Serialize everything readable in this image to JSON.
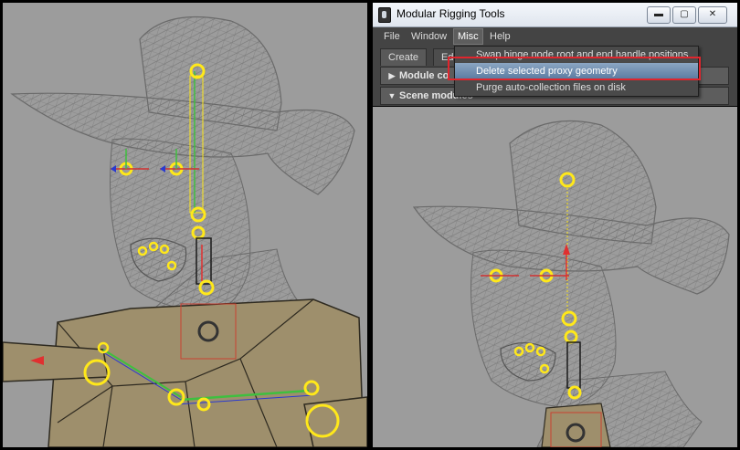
{
  "window": {
    "title": "Modular Rigging Tools",
    "minimize": "▬",
    "maximize": "▢",
    "close": "✕"
  },
  "menu_bar": {
    "items": [
      "File",
      "Window",
      "Misc",
      "Help"
    ]
  },
  "tabs": [
    "Create",
    "Ed"
  ],
  "frames": {
    "module_control": "Module co",
    "scene_modules": "Scene modules"
  },
  "misc_menu": {
    "items": [
      "Swap hinge node root and end handle positions",
      "Delete selected proxy geometry",
      "Purge auto-collection files on disk"
    ],
    "highlighted": "Delete selected proxy geometry"
  },
  "colors": {
    "viewport_bg": "#9c9c9c",
    "wireframe": "#6e6e6e",
    "joint_yellow": "#ffe81a",
    "highlight_red": "#e0252d",
    "menu_bg": "#444444",
    "selection_blue": "#6e8fb5"
  },
  "icons": {
    "app": "maya-icon",
    "collapsed_frame": "triangle-right-icon",
    "expanded_frame": "triangle-down-icon"
  }
}
